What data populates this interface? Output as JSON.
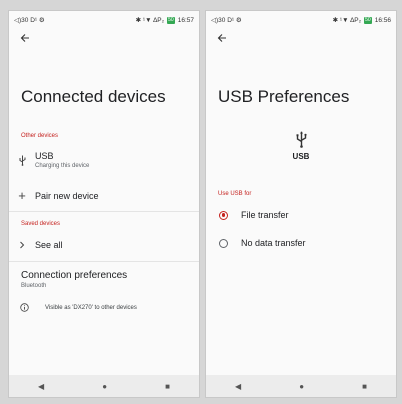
{
  "left_screen": {
    "status": {
      "left": "◁)30 D¹ ⚙",
      "right_icons": "✱ ¹▼ ∆P₂",
      "battery": "50",
      "time": "16:57"
    },
    "title": "Connected devices",
    "sections": {
      "other_devices": "Other devices",
      "saved_devices": "Saved devices"
    },
    "usb_row": {
      "label": "USB",
      "sublabel": "Charging this device"
    },
    "pair_row": {
      "label": "Pair new device"
    },
    "see_all_row": {
      "label": "See all"
    },
    "connection_prefs": {
      "label": "Connection preferences",
      "sublabel": "Bluetooth"
    },
    "info_text": "Visible as 'DX270' to other devices"
  },
  "right_screen": {
    "status": {
      "left": "◁)30 D¹ ⚙",
      "right_icons": "✱ ¹▼ ∆P₂",
      "battery": "50",
      "time": "16:56"
    },
    "title": "USB Preferences",
    "usb_label": "USB",
    "section": "Use USB for",
    "options": [
      {
        "label": "File transfer",
        "selected": true
      },
      {
        "label": "No data transfer",
        "selected": false
      }
    ]
  },
  "nav": {
    "back": "◀",
    "home": "●",
    "recents": "■"
  },
  "colors": {
    "accent": "#c5221f",
    "background": "#fafafa",
    "nav_bar": "#ececec"
  },
  "icons": {
    "back": "arrow-back-icon",
    "usb": "usb-icon",
    "add": "plus-icon",
    "chevron": "chevron-right-icon",
    "info": "info-icon"
  }
}
